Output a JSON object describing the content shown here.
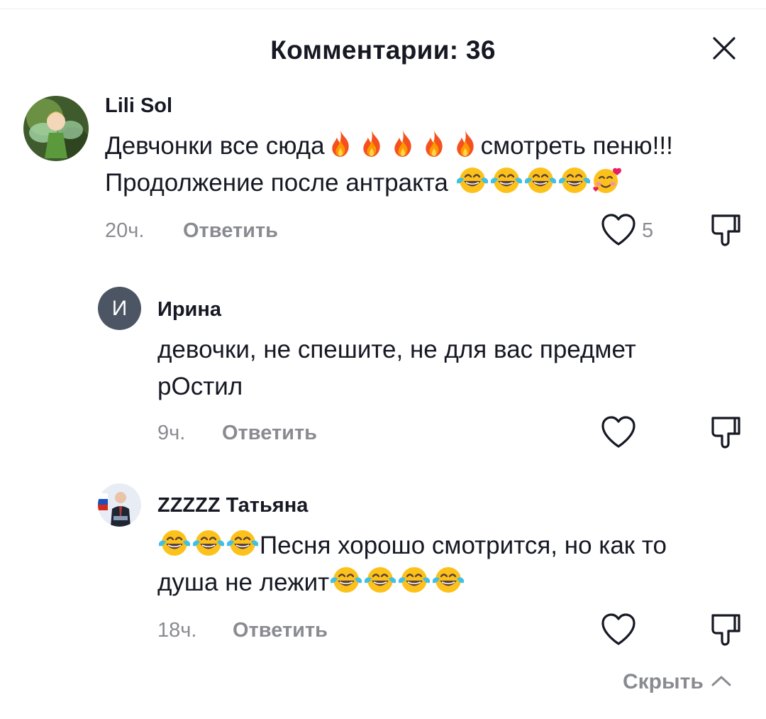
{
  "header": {
    "title": "Комментарии: 36"
  },
  "comments": [
    {
      "username": "Lili Sol",
      "line1_a": "Девчонки все сюда",
      "line1_b": "смотреть пеню!!!",
      "line2": "Продолжение после антракта ",
      "time": "20ч.",
      "reply_label": "Ответить",
      "like_count": "5"
    },
    {
      "avatar_letter": "И",
      "username": "Ирина",
      "line1": "девочки, не спешите, не для вас предмет",
      "line2": "рОстил",
      "time": "9ч.",
      "reply_label": "Ответить"
    },
    {
      "username": "ZZZZZ Татьяна",
      "line1": "Песня хорошо смотрится, но как то",
      "line2": "душа не лежит",
      "time": "18ч.",
      "reply_label": "Ответить"
    }
  ],
  "footer": {
    "hide_label": "Скрыть"
  },
  "colors": {
    "text": "#161823",
    "muted": "#8a8b91",
    "avatar_gray": "#4b5563"
  },
  "icons": [
    "close-icon",
    "heart-icon",
    "dislike-icon",
    "chevron-up-icon",
    "fire-emoji",
    "tears-of-joy-emoji",
    "smiling-hearts-emoji"
  ]
}
